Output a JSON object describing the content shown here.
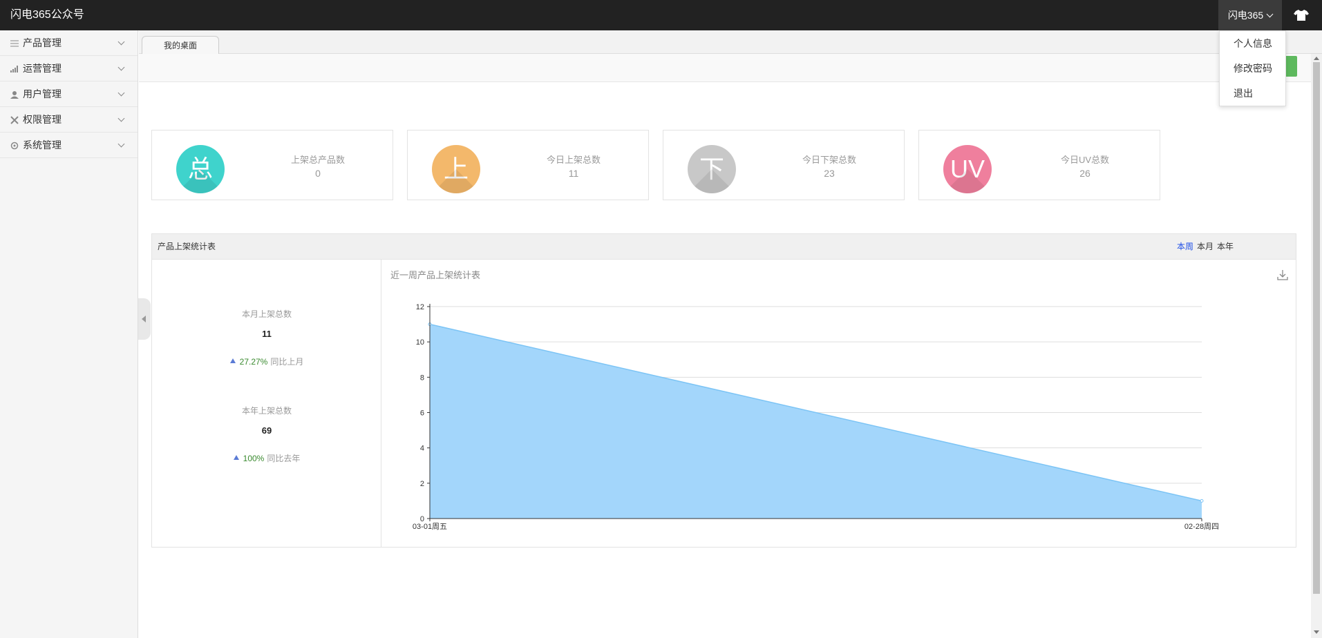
{
  "app": {
    "title": "闪电365公众号"
  },
  "header": {
    "user_name": "闪电365",
    "dropdown": [
      "个人信息",
      "修改密码",
      "退出"
    ]
  },
  "sidebar": {
    "items": [
      {
        "label": "产品管理",
        "icon": "list-icon"
      },
      {
        "label": "运营管理",
        "icon": "bar-chart-icon"
      },
      {
        "label": "用户管理",
        "icon": "user-icon"
      },
      {
        "label": "权限管理",
        "icon": "tools-icon"
      },
      {
        "label": "系统管理",
        "icon": "gear-icon"
      }
    ]
  },
  "tabs": [
    {
      "label": "我的桌面"
    }
  ],
  "cards": [
    {
      "glyph": "总",
      "title": "上架总产品数",
      "value": "0",
      "color": "#3fd3cc"
    },
    {
      "glyph": "上",
      "title": "今日上架总数",
      "value": "11",
      "color": "#f3b86b"
    },
    {
      "glyph": "下",
      "title": "今日下架总数",
      "value": "23",
      "color": "#c8c8c8"
    },
    {
      "glyph": "UV",
      "title": "今日UV总数",
      "value": "26",
      "color": "#ef7f9d"
    }
  ],
  "panel": {
    "title": "产品上架统计表",
    "ranges": [
      "本周",
      "本月",
      "本年"
    ],
    "active_range": "本周",
    "month": {
      "label": "本月上架总数",
      "value": "11",
      "pct": "27.27%",
      "compare": "同比上月"
    },
    "year": {
      "label": "本年上架总数",
      "value": "69",
      "pct": "100%",
      "compare": "同比去年"
    }
  },
  "chart_data": {
    "type": "area",
    "title": "近一周产品上架统计表",
    "categories": [
      "03-01周五",
      "02-28周四"
    ],
    "series": [
      {
        "values": [
          11,
          1
        ]
      }
    ],
    "ylim": [
      0,
      12
    ],
    "yticks": [
      0,
      2,
      4,
      6,
      8,
      10,
      12
    ],
    "grid": true,
    "fill_color": "#a3d6fb",
    "line_color": "#7cc4f5"
  }
}
